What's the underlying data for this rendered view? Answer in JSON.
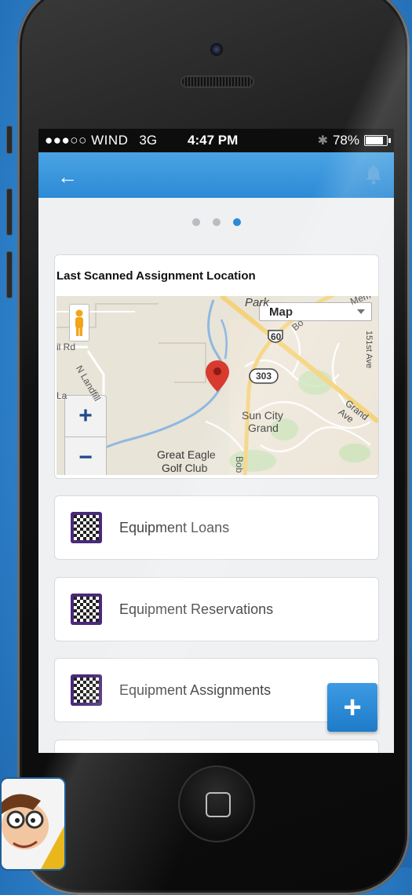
{
  "status_bar": {
    "carrier": "●●●○○ WIND",
    "network": "3G",
    "time": "4:47 PM",
    "bluetooth": "✱",
    "battery": "78%"
  },
  "app_bar": {
    "back_icon": "back-arrow-icon",
    "notification_icon": "bell-icon"
  },
  "pager": {
    "dots": 3,
    "active_index": 2
  },
  "map_card": {
    "title": "Last Scanned Assignment Location",
    "map_type_label": "Map",
    "zoom_in": "+",
    "zoom_out": "−",
    "labels": {
      "park": "Park",
      "mem": "Mem",
      "road_left": "il Rd",
      "landfill": "N Landfill",
      "route60": "60",
      "route303": "303",
      "ave151": "151st Ave",
      "sun_city": "Sun City",
      "grand": "Grand",
      "grand_ave": "Grand Ave",
      "golf1": "Great Eagle",
      "golf2": "Golf Club",
      "bob": "Bob",
      "bo": "Bo",
      "la": "La"
    }
  },
  "menu_items": [
    {
      "label": "Equipment Loans",
      "icon": "qr-code-icon"
    },
    {
      "label": "Equipment Reservations",
      "icon": "qr-code-icon"
    },
    {
      "label": "Equipment Assignments",
      "icon": "qr-code-icon"
    }
  ],
  "fab": {
    "label": "+"
  },
  "colors": {
    "accent": "#2c8ad6",
    "qr_bg": "#4a2a7a",
    "pin": "#d83a2e"
  }
}
